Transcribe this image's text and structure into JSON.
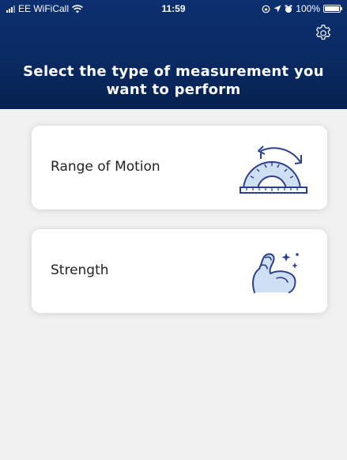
{
  "status_bar": {
    "carrier": "EE WiFiCall",
    "time": "11:59",
    "battery": "100%",
    "battery_level": 1.0
  },
  "header": {
    "title": "Select the type of measurement you want to perform",
    "settings_icon": "gear-icon"
  },
  "cards": [
    {
      "label": "Range of Motion",
      "icon": "protractor-icon"
    },
    {
      "label": "Strength",
      "icon": "flexed-arm-icon"
    }
  ],
  "colors": {
    "header_bg": "#0a2a62",
    "icon_blue": "#2a3f8f",
    "card_bg": "#ffffff",
    "page_bg": "#f1f1f1"
  }
}
